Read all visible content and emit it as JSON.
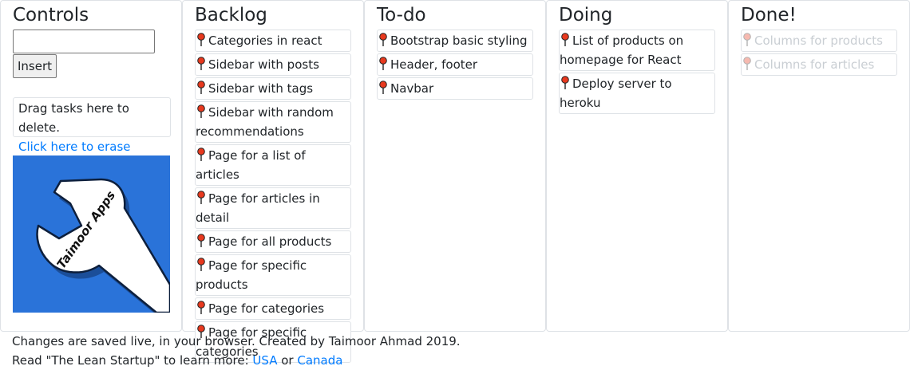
{
  "controls": {
    "title": "Controls",
    "input_value": "",
    "insert_label": "Insert",
    "trash_text": "Drag tasks here to delete.",
    "erase_link": "Click here to erase board.",
    "logo_text": "Taimoor Apps"
  },
  "columns": [
    {
      "title": "Backlog",
      "cards": [
        "Categories in react",
        "Sidebar with posts",
        "Sidebar with tags",
        "Sidebar with random recommendations",
        "Page for a list of articles",
        "Page for articles in detail",
        "Page for all products",
        "Page for specific products",
        "Page for categories",
        "Page for specific categories"
      ]
    },
    {
      "title": "To-do",
      "cards": [
        "Bootstrap basic styling",
        "Header, footer",
        "Navbar"
      ]
    },
    {
      "title": "Doing",
      "cards": [
        "List of products on homepage for React",
        "Deploy server to heroku"
      ]
    },
    {
      "title": "Done!",
      "cards": [
        "Columns for products",
        "Columns for articles"
      ]
    }
  ],
  "footer": {
    "line1": "Changes are saved live, in your browser. Created by Taimoor Ahmad 2019.",
    "line2_prefix": "Read \"The Lean Startup\" to learn more: ",
    "link_usa": "USA",
    "or_text": " or ",
    "link_canada": "Canada"
  },
  "colors": {
    "link": "#007bff",
    "logo_bg": "#2a73d9",
    "pin_head": "#e8391e"
  }
}
